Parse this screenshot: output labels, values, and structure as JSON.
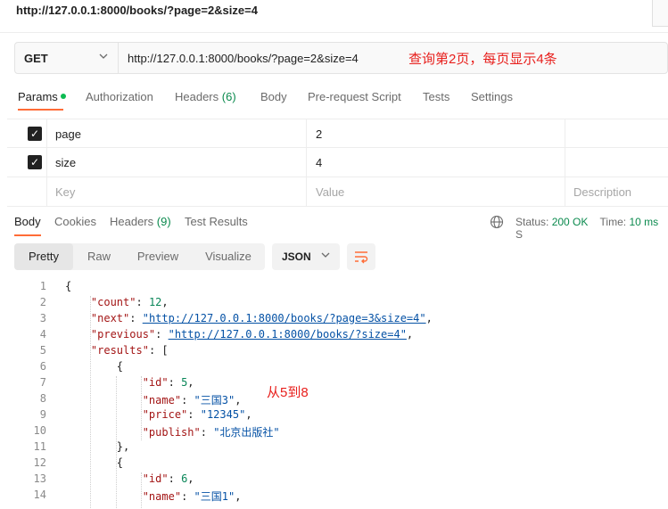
{
  "window": {
    "url_title": "http://127.0.0.1:8000/books/?page=2&size=4"
  },
  "request": {
    "method": "GET",
    "url": "http://127.0.0.1:8000/books/?page=2&size=4",
    "annotation": "查询第2页，每页显示4条"
  },
  "request_tabs": {
    "params": "Params",
    "authorization": "Authorization",
    "headers": "Headers",
    "headers_count": "(6)",
    "body": "Body",
    "prerequest": "Pre-request Script",
    "tests": "Tests",
    "settings": "Settings"
  },
  "params": {
    "rows": [
      {
        "key": "page",
        "value": "2",
        "checked": true
      },
      {
        "key": "size",
        "value": "4",
        "checked": true
      }
    ],
    "placeholder": {
      "key": "Key",
      "value": "Value",
      "description": "Description"
    }
  },
  "response_tabs": {
    "body": "Body",
    "cookies": "Cookies",
    "headers": "Headers",
    "headers_count": "(9)",
    "test_results": "Test Results"
  },
  "response_status": {
    "status_label": "Status:",
    "status_value": "200 OK",
    "time_label": "Time:",
    "time_value": "10 ms",
    "size_label": "S"
  },
  "view_modes": {
    "pretty": "Pretty",
    "raw": "Raw",
    "preview": "Preview",
    "visualize": "Visualize"
  },
  "format": "JSON",
  "code": {
    "line_numbers": [
      "1",
      "2",
      "3",
      "4",
      "5",
      "6",
      "7",
      "8",
      "9",
      "10",
      "11",
      "12",
      "13",
      "14"
    ],
    "count_key": "\"count\"",
    "count_value": "12",
    "next_key": "\"next\"",
    "next_value": "\"http://127.0.0.1:8000/books/?page=3&size=4\"",
    "previous_key": "\"previous\"",
    "previous_value": "\"http://127.0.0.1:8000/books/?size=4\"",
    "results_key": "\"results\"",
    "id_key": "\"id\"",
    "id_value_1": "5",
    "id_value_2": "6",
    "name_key": "\"name\"",
    "name_value_1": "\"三国3\"",
    "name_value_2": "\"三国1\"",
    "price_key": "\"price\"",
    "price_value_1": "\"12345\"",
    "publish_key": "\"publish\"",
    "publish_value_1": "\"北京出版社\""
  },
  "annotation_2": "从5到8",
  "colors": {
    "accent": "#ff6c37",
    "status_ok": "#0b8a4e",
    "annotation": "#e8201d"
  }
}
